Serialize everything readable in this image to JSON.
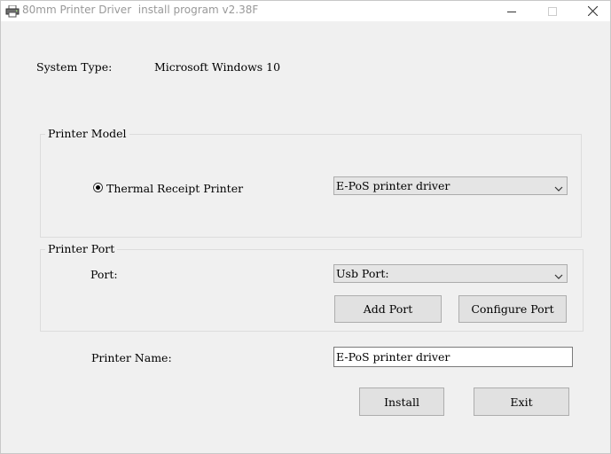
{
  "window": {
    "title": "80mm Printer Driver  install program v2.38F",
    "icons": {
      "app": "printer-icon",
      "minimize": "minimize-icon",
      "maximize": "maximize-icon",
      "close": "close-icon"
    }
  },
  "system": {
    "label": "System Type:",
    "value": "Microsoft Windows 10"
  },
  "printer_model": {
    "group_label": "Printer Model",
    "radio_label": "Thermal Receipt Printer",
    "radio_selected": true,
    "driver_selected": "E-PoS printer driver"
  },
  "printer_port": {
    "group_label": "Printer Port",
    "port_label": "Port:",
    "port_selected": "Usb Port:",
    "add_port_label": "Add Port",
    "configure_port_label": "Configure Port"
  },
  "printer_name": {
    "label": "Printer Name:",
    "value": "E-PoS printer driver"
  },
  "actions": {
    "install_label": "Install",
    "exit_label": "Exit"
  },
  "colors": {
    "window_bg": "#f0f0f0",
    "titlebar_bg": "#ffffff",
    "title_text": "#999999",
    "button_bg": "#e1e1e1",
    "combo_bg": "#e5e5e5"
  }
}
